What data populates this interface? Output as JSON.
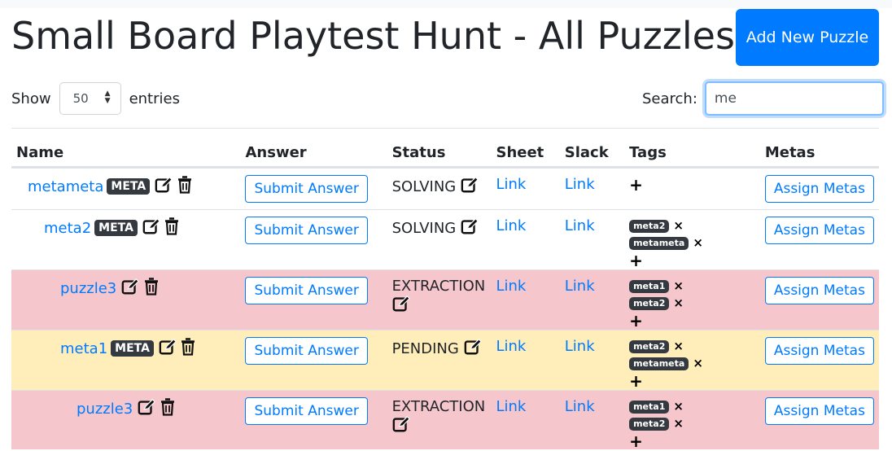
{
  "header": {
    "title": "Small Board Playtest Hunt - All Puzzles",
    "add_button_label": "Add New Puzzle"
  },
  "controls": {
    "show_label": "Show",
    "entries_value": "50",
    "entries_label": "entries",
    "search_label": "Search:",
    "search_value": "me"
  },
  "table": {
    "headers": [
      "Name",
      "Answer",
      "Status",
      "Sheet",
      "Slack",
      "Tags",
      "Metas"
    ],
    "submit_label": "Submit Answer",
    "link_label": "Link",
    "assign_label": "Assign Metas",
    "add_tag_symbol": "+",
    "remove_tag_symbol": "×",
    "rows": [
      {
        "name": "metameta",
        "badge": "META",
        "status": "SOLVING",
        "tags": [],
        "row_color": "#ffffff"
      },
      {
        "name": "meta2",
        "badge": "META",
        "status": "SOLVING",
        "tags": [
          "meta2",
          "metameta"
        ],
        "row_color": "#ffffff"
      },
      {
        "name": "puzzle3",
        "badge": "",
        "status": "EXTRACTION",
        "tags": [
          "meta1",
          "meta2"
        ],
        "row_color": "#f5c6cb"
      },
      {
        "name": "meta1",
        "badge": "META",
        "status": "PENDING",
        "tags": [
          "meta2",
          "metameta"
        ],
        "row_color": "#ffeeba"
      },
      {
        "name": "puzzle3",
        "badge": "",
        "status": "EXTRACTION",
        "tags": [
          "meta1",
          "meta2"
        ],
        "row_color": "#f5c6cb"
      }
    ]
  },
  "colors": {
    "primary": "#007bff",
    "extraction_row": "#f5c6cb",
    "pending_row": "#ffeeba",
    "badge": "#343a40"
  },
  "icons": {
    "edit": "edit-icon",
    "delete": "trash-icon",
    "remove_tag": "close-icon",
    "add_tag": "plus-icon",
    "select_arrows": "sort-arrows-icon"
  }
}
